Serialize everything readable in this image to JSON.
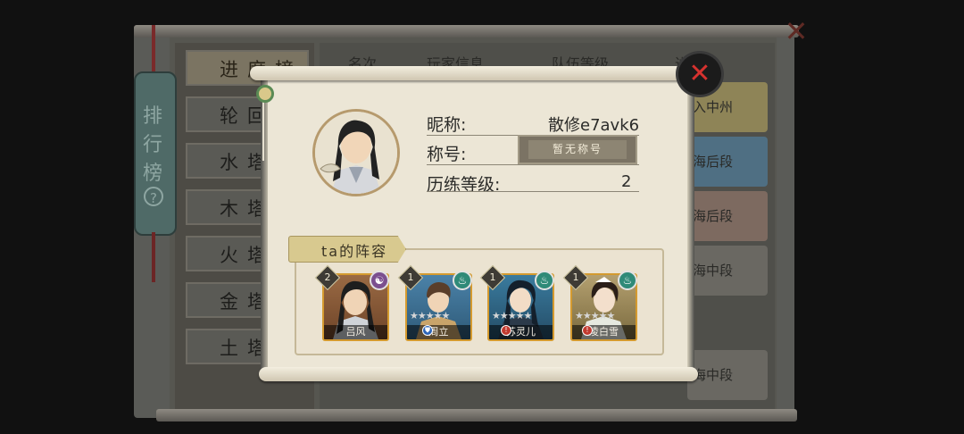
{
  "board": {
    "tabs": [
      "进度榜",
      "轮回",
      "水塔",
      "木塔榜",
      "火塔榜",
      "金塔榜",
      "土塔榜"
    ],
    "columns": [
      "名次",
      "玩家信息",
      "队伍等级",
      "进"
    ],
    "rows": [
      "入中州",
      "海后段",
      "海后段",
      "海中段",
      "海中段"
    ],
    "banner": [
      "排",
      "行",
      "榜"
    ],
    "banner_help": "?",
    "close": "✕"
  },
  "dialog": {
    "close": "✕",
    "nickname_label": "昵称:",
    "nickname_value": "散修e7avk6",
    "title_label": "称号:",
    "title_value": "暂无称号",
    "level_label": "历练等级:",
    "level_value": "2",
    "lineup_title": "ta的阵容",
    "heroes": [
      {
        "name": "吕风",
        "level": "2",
        "element": "yin-yang-icon",
        "element_glyph": "☯",
        "stars": 0,
        "colors": {
          "bg": "#8a5a37",
          "elem": "#7b4f8f"
        }
      },
      {
        "name": "周立",
        "level": "1",
        "element": "wind-icon",
        "element_glyph": "♨",
        "stars": 5,
        "role_glyph": "⛊",
        "colors": {
          "bg": "#3e6f93",
          "elem": "#2f8a78",
          "role": "#2c64b6"
        }
      },
      {
        "name": "苏灵儿",
        "level": "1",
        "element": "wind-icon",
        "element_glyph": "♨",
        "stars": 5,
        "role_glyph": "!",
        "colors": {
          "bg": "#2f6a8a",
          "elem": "#2f8a78",
          "role": "#c23a2f"
        }
      },
      {
        "name": "凌白雪",
        "level": "1",
        "element": "wind-icon",
        "element_glyph": "♨",
        "stars": 5,
        "role_glyph": "!",
        "colors": {
          "bg": "#8a7a48",
          "elem": "#2f8a78",
          "role": "#c23a2f"
        }
      }
    ]
  }
}
